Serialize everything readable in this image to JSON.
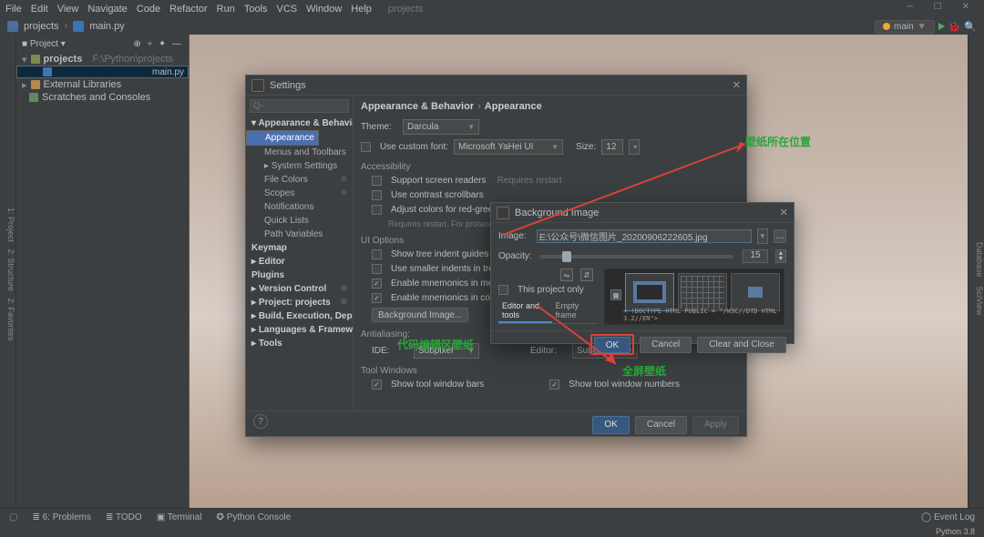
{
  "menu": {
    "items": [
      "File",
      "Edit",
      "View",
      "Navigate",
      "Code",
      "Refactor",
      "Run",
      "Tools",
      "VCS",
      "Window",
      "Help"
    ],
    "project": "projects"
  },
  "crumb": {
    "project": "projects",
    "file": "main.py",
    "run_config": "main"
  },
  "sidebar": {
    "header": "Project",
    "items": [
      {
        "label": "projects",
        "hint": "F:\\Python\\projects"
      },
      {
        "label": "main.py"
      },
      {
        "label": "External Libraries"
      },
      {
        "label": "Scratches and Consoles"
      }
    ]
  },
  "settings": {
    "title": "Settings",
    "search_placeholder": "Q-",
    "nav": [
      {
        "label": "Appearance & Behavior",
        "bold": true
      },
      {
        "label": "Appearance",
        "sub": true,
        "sel": true
      },
      {
        "label": "Menus and Toolbars",
        "sub": true
      },
      {
        "label": "System Settings",
        "sub": true,
        "arrow": true
      },
      {
        "label": "File Colors",
        "sub": true,
        "gear": true
      },
      {
        "label": "Scopes",
        "sub": true,
        "gear": true
      },
      {
        "label": "Notifications",
        "sub": true
      },
      {
        "label": "Quick Lists",
        "sub": true
      },
      {
        "label": "Path Variables",
        "sub": true
      },
      {
        "label": "Keymap",
        "bold": true
      },
      {
        "label": "Editor",
        "bold": true,
        "arrow": true
      },
      {
        "label": "Plugins",
        "bold": true
      },
      {
        "label": "Version Control",
        "bold": true,
        "arrow": true,
        "gear": true
      },
      {
        "label": "Project: projects",
        "bold": true,
        "arrow": true,
        "gear": true
      },
      {
        "label": "Build, Execution, Deployment",
        "bold": true,
        "arrow": true
      },
      {
        "label": "Languages & Frameworks",
        "bold": true,
        "arrow": true
      },
      {
        "label": "Tools",
        "bold": true,
        "arrow": true
      }
    ],
    "breadcrumb": [
      "Appearance & Behavior",
      "Appearance"
    ],
    "theme_label": "Theme:",
    "theme_value": "Darcula",
    "custom_font_label": "Use custom font:",
    "font_value": "Microsoft YaHei UI",
    "size_label": "Size:",
    "size_value": "12",
    "accessibility": "Accessibility",
    "acc1": "Support screen readers",
    "acc1_hint": "Requires restart",
    "acc2": "Use contrast scrollbars",
    "acc3": "Adjust colors for red-green visio",
    "acc3_hint": "Requires restart. For protanopia",
    "uiopt": "UI Options",
    "u1": "Show tree indent guides",
    "u2": "Use smaller indents in trees",
    "u3": "Enable mnemonics in menu",
    "u4": "Enable mnemonics in controls",
    "bg_btn": "Background Image...",
    "antialiasing": "Antialiasing:",
    "ide_label": "IDE:",
    "ide_value": "Subpixel",
    "editor_aa_label": "Editor:",
    "editor_aa_value": "Subpixel",
    "toolwin": "Tool Windows",
    "tw1": "Show tool window bars",
    "tw2": "Show tool window numbers",
    "ok": "OK",
    "cancel": "Cancel",
    "apply": "Apply"
  },
  "bgdlg": {
    "title": "Background Image",
    "image_label": "Image:",
    "image_path": "E:\\公众号\\微信图片_20200906222605.jpg",
    "opacity_label": "Opacity:",
    "opacity_value": "15",
    "project_only": "This project only",
    "tab1": "Editor and tools",
    "tab2": "Empty frame",
    "preview_snip": "< !DOCTYPE HTML PUBLIC = \"/W3C//DTD HTML 3.2//EN\">",
    "ok": "OK",
    "cancel": "Cancel",
    "clear": "Clear and Close"
  },
  "bottom": {
    "items": [
      "Problems",
      "TODO",
      "Terminal",
      "Python Console"
    ],
    "event": "Event Log",
    "python": "Python 3.8"
  },
  "anno": {
    "a1": "壁纸所在位置",
    "a2": "代码编辑区壁纸",
    "a3": "全屏壁纸"
  }
}
